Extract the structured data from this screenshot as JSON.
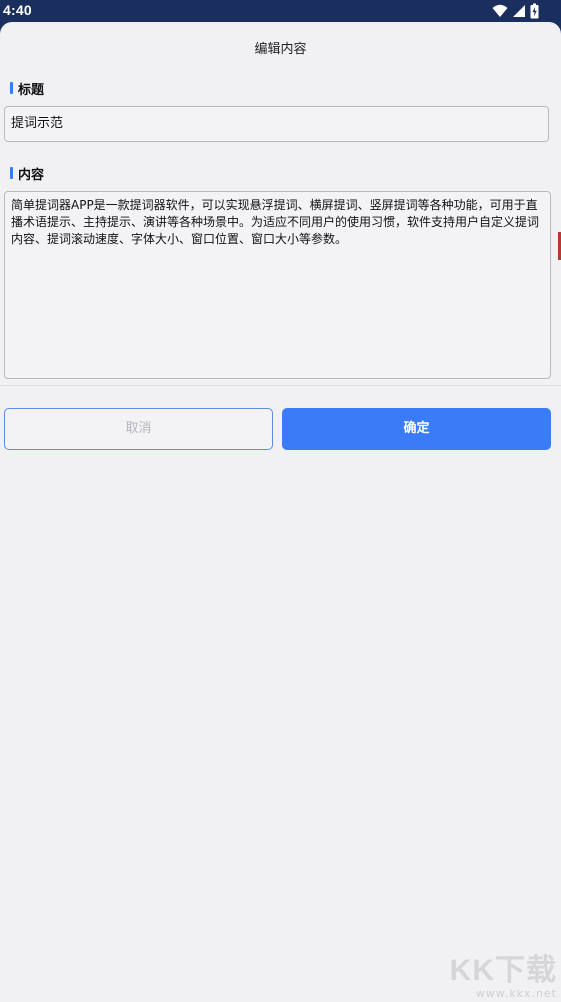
{
  "status_bar": {
    "time": "4:40",
    "icons": [
      "wifi-icon",
      "cellular-signal-icon",
      "battery-icon"
    ]
  },
  "dialog": {
    "title": "编辑内容",
    "title_section": {
      "label": "标题",
      "value": "提词示范"
    },
    "content_section": {
      "label": "内容",
      "value": "简单提词器APP是一款提词器软件，可以实现悬浮提词、横屏提词、竖屏提词等各种功能，可用于直播术语提示、主持提示、演讲等各种场景中。为适应不同用户的使用习惯，软件支持用户自定义提词内容、提词滚动速度、字体大小、窗口位置、窗口大小等参数。"
    },
    "buttons": {
      "cancel_label": "取消",
      "confirm_label": "确定"
    }
  },
  "watermark": {
    "logo_text": "KK下载",
    "url": "www.kkx.net"
  },
  "colors": {
    "status_bar_bg": "#1a2f5e",
    "accent": "#3a7bf7",
    "sheet_bg": "#f1f1f4"
  }
}
